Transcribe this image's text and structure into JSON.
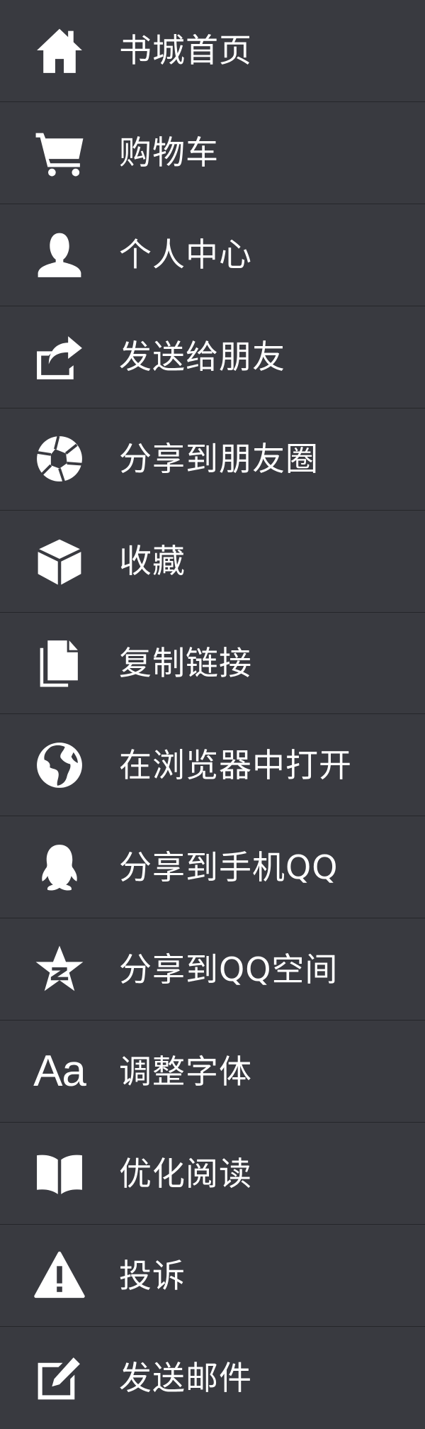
{
  "menu": {
    "items": [
      {
        "key": "home",
        "label": "书城首页",
        "icon": "home-icon"
      },
      {
        "key": "cart",
        "label": "购物车",
        "icon": "cart-icon"
      },
      {
        "key": "profile",
        "label": "个人中心",
        "icon": "user-icon"
      },
      {
        "key": "send-friend",
        "label": "发送给朋友",
        "icon": "share-icon"
      },
      {
        "key": "moments",
        "label": "分享到朋友圈",
        "icon": "aperture-icon"
      },
      {
        "key": "favorite",
        "label": "收藏",
        "icon": "cube-icon"
      },
      {
        "key": "copy-link",
        "label": "复制链接",
        "icon": "copy-icon"
      },
      {
        "key": "open-browser",
        "label": "在浏览器中打开",
        "icon": "globe-icon"
      },
      {
        "key": "share-qq",
        "label": "分享到手机QQ",
        "icon": "qq-icon"
      },
      {
        "key": "share-qzone",
        "label": "分享到QQ空间",
        "icon": "qzone-icon"
      },
      {
        "key": "font",
        "label": "调整字体",
        "icon": "font-size-icon",
        "glyph": "Aa"
      },
      {
        "key": "optimize",
        "label": "优化阅读",
        "icon": "book-icon"
      },
      {
        "key": "report",
        "label": "投诉",
        "icon": "warning-icon"
      },
      {
        "key": "email",
        "label": "发送邮件",
        "icon": "edit-icon"
      }
    ]
  },
  "colors": {
    "background": "#393a40",
    "divider": "#25262a",
    "text": "#ffffff"
  }
}
